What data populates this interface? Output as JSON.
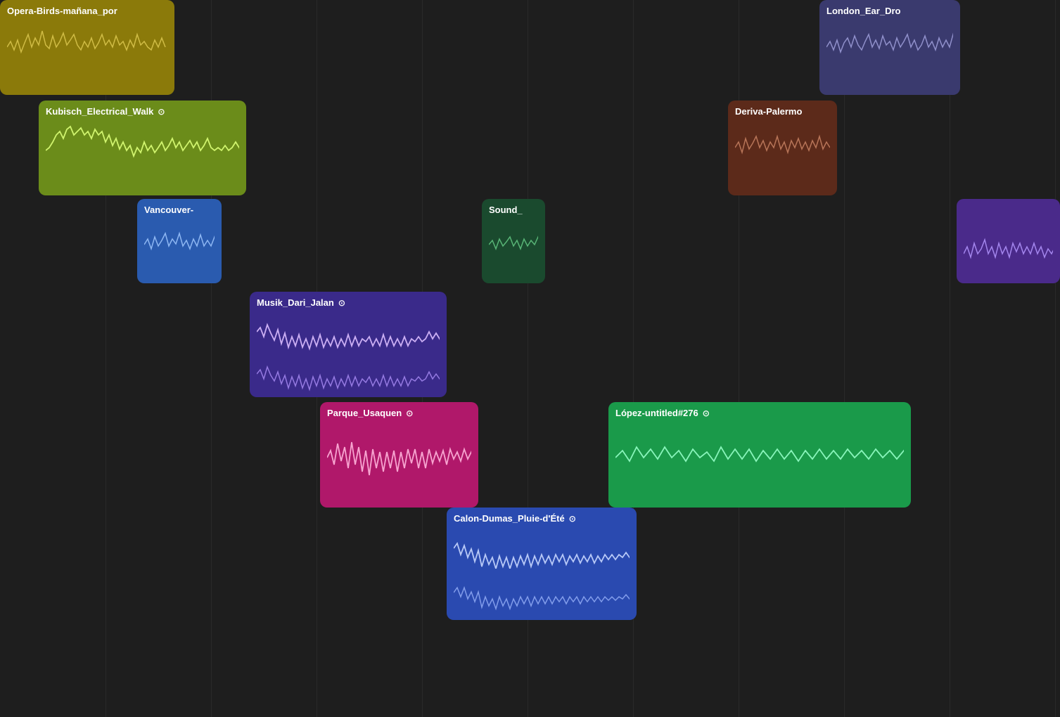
{
  "grid": {
    "lines": [
      150,
      300,
      450,
      600,
      750,
      900,
      1050,
      1200,
      1350,
      1500
    ]
  },
  "cards": [
    {
      "id": "opera",
      "title": "Opera-Birds-mañana_por",
      "hasLoop": false,
      "color": "#8B7A0A",
      "class": "card-opera",
      "waveformLines": 1,
      "waveColor": "rgba(220,200,80,0.85)"
    },
    {
      "id": "london",
      "title": "London_Ear_Dro",
      "hasLoop": false,
      "color": "#3a3a6e",
      "class": "card-london",
      "waveformLines": 1,
      "waveColor": "rgba(160,160,220,0.85)"
    },
    {
      "id": "kubisch",
      "title": "Kubisch_Electrical_Walk",
      "hasLoop": true,
      "color": "#6b8c1a",
      "class": "card-kubisch",
      "waveformLines": 1,
      "waveColor": "rgba(220,255,120,0.9)"
    },
    {
      "id": "deriva",
      "title": "Deriva-Palermo",
      "hasLoop": false,
      "color": "#5c2a1a",
      "class": "card-deriva",
      "waveformLines": 1,
      "waveColor": "rgba(200,130,100,0.85)"
    },
    {
      "id": "vancouver",
      "title": "Vancouver-",
      "hasLoop": false,
      "color": "#2a5baf",
      "class": "card-vancouver",
      "waveformLines": 1,
      "waveColor": "rgba(160,200,255,0.85)"
    },
    {
      "id": "sound",
      "title": "Sound_",
      "hasLoop": false,
      "color": "#1a4a2e",
      "class": "card-sound",
      "waveformLines": 1,
      "waveColor": "rgba(100,200,130,0.85)"
    },
    {
      "id": "musik",
      "title": "Musik_Dari_Jalan",
      "hasLoop": true,
      "color": "#3a2a8a",
      "class": "card-musik",
      "waveformLines": 2,
      "waveColor": "rgba(200,170,255,0.85)"
    },
    {
      "id": "parque",
      "title": "Parque_Usaquen",
      "hasLoop": true,
      "color": "#b0186a",
      "class": "card-parque",
      "waveformLines": 1,
      "waveColor": "rgba(255,180,220,0.9)"
    },
    {
      "id": "lopez",
      "title": "López-untitled#276",
      "hasLoop": true,
      "color": "#1a9a4a",
      "class": "card-lopez",
      "waveformLines": 1,
      "waveColor": "rgba(150,255,200,0.9)"
    },
    {
      "id": "calon",
      "title": "Calon-Dumas_Pluie-d'Été",
      "hasLoop": true,
      "color": "#2a4ab0",
      "class": "card-calon",
      "waveformLines": 2,
      "waveColor": "rgba(180,200,255,0.9)"
    }
  ]
}
